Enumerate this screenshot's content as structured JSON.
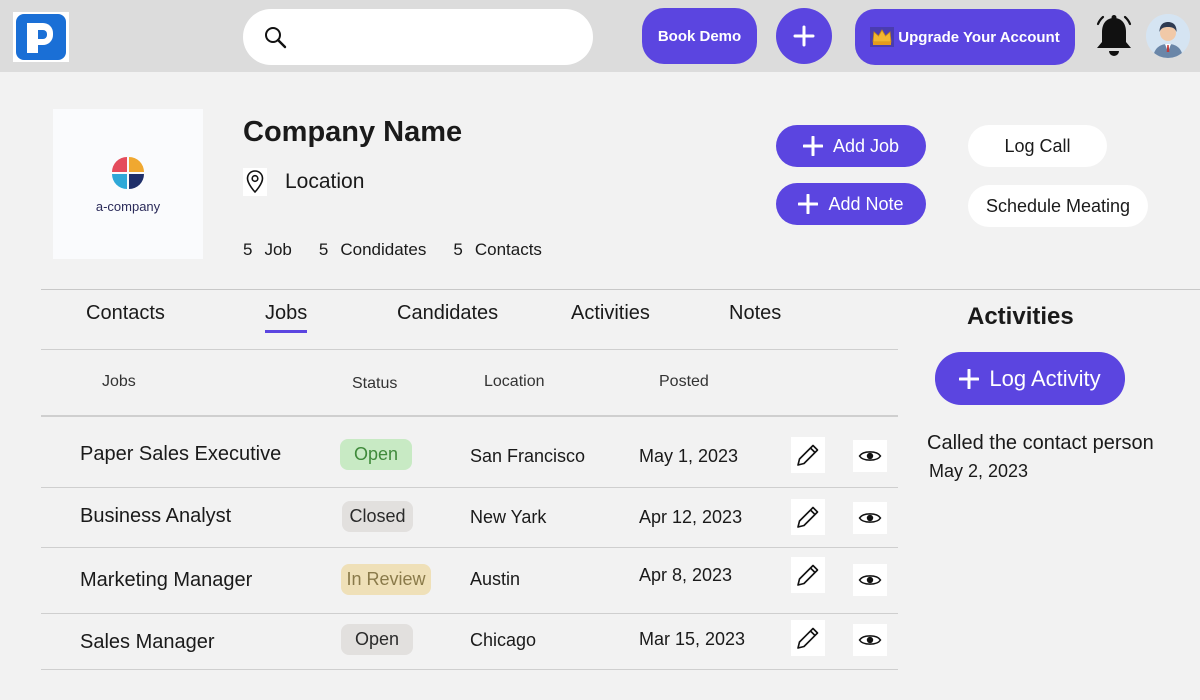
{
  "topbar": {
    "search_placeholder": "",
    "book_demo_label": "Book Demo",
    "upgrade_label": "Upgrade Your Account",
    "upgrade_icon": "crown-icon",
    "accent_color": "#5b45e0"
  },
  "company": {
    "logo_text": "a-company",
    "name": "Company Name",
    "location": "Location",
    "stats": [
      {
        "count": "5",
        "label": "Job"
      },
      {
        "count": "5",
        "label": "Condidates"
      },
      {
        "count": "5",
        "label": "Contacts"
      }
    ],
    "actions": {
      "add_job": "Add Job",
      "add_note": "Add Note",
      "log_call": "Log Call",
      "schedule_meeting": "Schedule Meating"
    }
  },
  "tabs": [
    {
      "label": "Contacts",
      "active": false
    },
    {
      "label": "Jobs",
      "active": true
    },
    {
      "label": "Candidates",
      "active": false
    },
    {
      "label": "Activities",
      "active": false
    },
    {
      "label": "Notes",
      "active": false
    }
  ],
  "table": {
    "headers": [
      "Jobs",
      "Status",
      "Location",
      "Posted"
    ],
    "rows": [
      {
        "job": "Paper Sales Executive",
        "status": "Open",
        "location": "San Francisco",
        "posted": "May 1, 2023"
      },
      {
        "job": "Business Analyst",
        "status": "Closed",
        "location": "New Yark",
        "posted": "Apr 12, 2023"
      },
      {
        "job": "Marketing Manager",
        "status": "In Review",
        "location": "Austin",
        "posted": "Apr 8, 2023"
      },
      {
        "job": "Sales Manager",
        "status": "Open",
        "location": "Chicago",
        "posted": "Mar 15, 2023"
      }
    ]
  },
  "activities": {
    "title": "Activities",
    "log_button": "Log Activity",
    "items": [
      {
        "text": "Called the contact person",
        "date": "May 2, 2023"
      }
    ]
  }
}
